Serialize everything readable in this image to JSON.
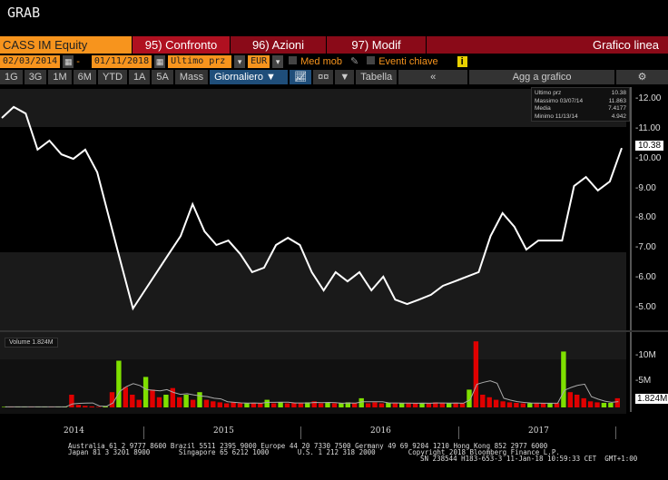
{
  "window_title": "GRAB",
  "toolbar": {
    "ticker": "CASS IM Equity",
    "confronto": "95) Confronto",
    "azioni": "96) Azioni",
    "modif": "97) Modif",
    "chart_type": "Grafico linea"
  },
  "params": {
    "start_date": "02/03/2014",
    "dash": "-",
    "end_date": "01/11/2018",
    "field": "Ultimo prz",
    "currency": "EUR",
    "med_mob": "Med mob",
    "eventi": "Eventi chiave",
    "info": "i"
  },
  "periods": [
    "1G",
    "3G",
    "1M",
    "6M",
    "YTD",
    "1A",
    "5A",
    "Mass"
  ],
  "freq": "Giornaliero ▼",
  "tabella": "Tabella",
  "back": "«",
  "agg": "Agg a grafico",
  "gear": "⚙",
  "legend": {
    "ultimo_label": "Ultimo prz",
    "ultimo": "10.38",
    "max_label": "Massimo 03/07/14",
    "max": "11.863",
    "media_label": "Media",
    "media": "7.4177",
    "min_label": "Minimo 11/13/14",
    "min": "4.942"
  },
  "volume_label": "Volume 1.824M",
  "colors": {
    "up": "#7fe000",
    "down": "#e00000",
    "ticker_bg": "#f7941d",
    "menu_bg": "#b01020"
  },
  "chart_data": [
    {
      "type": "line",
      "title": "CASS IM Equity - Ultimo prz",
      "ylim": [
        4.6,
        12.4
      ],
      "yticks": [
        "12.00",
        "11.00",
        "10.00",
        "9.00",
        "8.00",
        "7.00",
        "6.00",
        "5.00"
      ],
      "last_label": "10.38",
      "values": [
        11.39,
        11.76,
        11.54,
        10.33,
        10.63,
        10.17,
        10.02,
        10.33,
        9.57,
        8.04,
        6.52,
        5.0,
        5.61,
        6.22,
        6.83,
        7.43,
        8.5,
        7.59,
        7.13,
        7.28,
        6.83,
        6.22,
        6.37,
        7.13,
        7.37,
        7.13,
        6.22,
        5.61,
        6.22,
        5.91,
        6.22,
        5.61,
        6.07,
        5.3,
        5.15,
        5.3,
        5.46,
        5.76,
        5.91,
        6.07,
        6.22,
        7.43,
        8.2,
        7.74,
        6.98,
        7.28,
        7.28,
        7.28,
        9.11,
        9.41,
        8.96,
        9.26,
        10.38
      ],
      "xticks": [
        "2014",
        "2015",
        "2016",
        "2017"
      ]
    },
    {
      "type": "bar",
      "title": "Volume",
      "ylim": [
        0,
        14
      ],
      "unit": "M",
      "yticks": [
        "10M",
        "5M"
      ],
      "last_label": "1.824M",
      "values": [
        0.1,
        0.1,
        0.1,
        0.1,
        0.1,
        0.1,
        0.1,
        0.1,
        0.1,
        0.1,
        2.5,
        0.5,
        0.3,
        0.2,
        0.1,
        0.2,
        3,
        9.2,
        4,
        2.5,
        1.5,
        6,
        3.5,
        2,
        2.5,
        3.8,
        2,
        2.5,
        1.5,
        3,
        1.5,
        1.2,
        1,
        0.8,
        1,
        0.8,
        0.8,
        0.9,
        0.8,
        1.5,
        0.8,
        1,
        0.8,
        0.9,
        0.8,
        1,
        1.2,
        0.8,
        0.9,
        0.8,
        0.8,
        1,
        0.8,
        1.8,
        0.8,
        1,
        0.8,
        0.9,
        0.8,
        0.9,
        0.8,
        0.8,
        0.9,
        0.8,
        1,
        0.8,
        0.8,
        0.9,
        0.8,
        3.5,
        13,
        2.5,
        2,
        1.5,
        1.2,
        1,
        0.9,
        0.8,
        0.8,
        0.9,
        0.8,
        0.8,
        0.9,
        11,
        3,
        2.5,
        1.8,
        1.2,
        1,
        0.9,
        0.9,
        1.8
      ],
      "ma_label": "1.824M"
    }
  ],
  "footer": {
    "line1": "Australia 61 2 9777 8600 Brazil 5511 2395 9000 Europe 44 20 7330 7500 Germany 49 69 9204 1210 Hong Kong 852 2977 6000",
    "line2": "Japan 81 3 3201 8900       Singapore 65 6212 1000       U.S. 1 212 318 2000        Copyright 2018 Bloomberg Finance L.P.",
    "line3": "SN 238544 H183-653-3 11-Jan-18 10:59:33 CET  GMT+1:00"
  }
}
